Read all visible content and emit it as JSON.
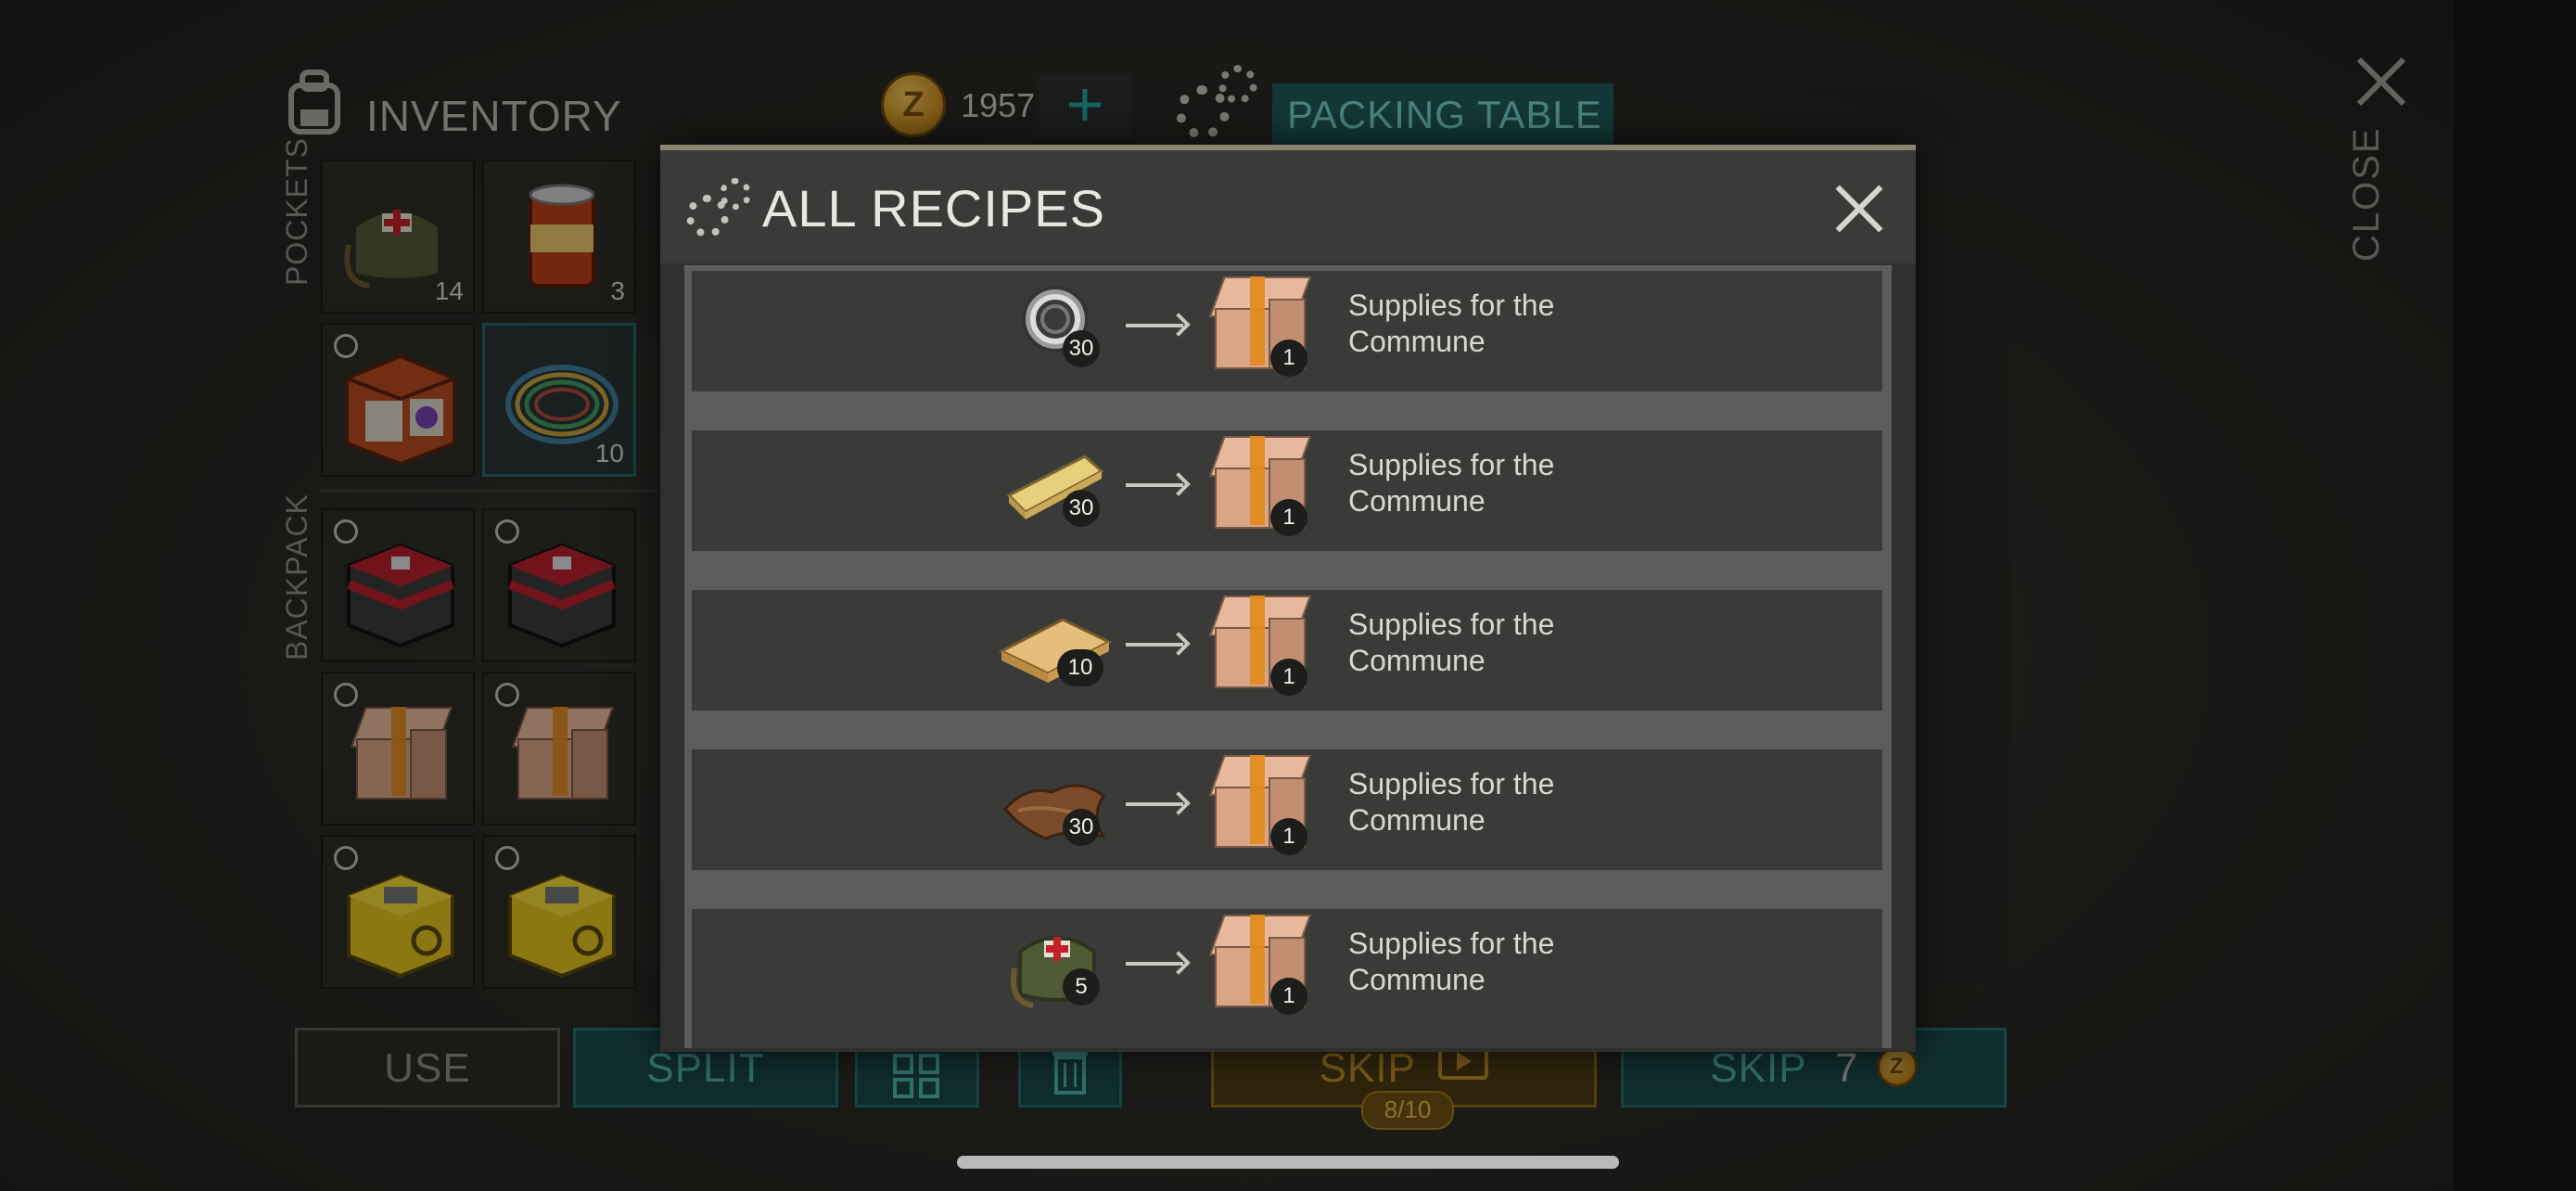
{
  "inventory": {
    "title": "INVENTORY",
    "pockets_label": "POCKETS",
    "backpack_label": "BACKPACK",
    "pocket_slots": [
      {
        "icon": "medical-bag-icon",
        "count": "14"
      },
      {
        "icon": "food-can-icon",
        "count": "3"
      },
      {
        "icon": "supply-crate-icon",
        "count": ""
      },
      {
        "icon": "rope-icon",
        "count": "10"
      }
    ],
    "backpack_slots": [
      {
        "icon": "toolbox-icon"
      },
      {
        "icon": "toolbox-icon"
      },
      {
        "icon": "cardboard-box-icon"
      },
      {
        "icon": "cardboard-box-icon"
      },
      {
        "icon": "hazard-case-icon"
      },
      {
        "icon": "hazard-case-icon"
      }
    ]
  },
  "currency": {
    "icon": "coin-icon",
    "coin_symbol": "Z",
    "amount": "1957",
    "add_label": "+"
  },
  "workbench": {
    "title": "PACKING TABLE"
  },
  "close": {
    "label": "CLOSE"
  },
  "actions": {
    "use": "USE",
    "split": "SPLIT",
    "skip_ad": "SKIP",
    "skip_ad_counter": "8/10",
    "skip_coins": "SKIP",
    "skip_coins_cost": "7"
  },
  "modal": {
    "title": "ALL RECIPES",
    "recipes": [
      {
        "input_icon": "bearing-icon",
        "input_qty": "30",
        "output_icon": "cardboard-box-icon",
        "output_qty": "1",
        "output_name": "Supplies for the Commune"
      },
      {
        "input_icon": "wood-plank-icon",
        "input_qty": "30",
        "output_icon": "cardboard-box-icon",
        "output_qty": "1",
        "output_name": "Supplies for the Commune"
      },
      {
        "input_icon": "board-icon",
        "input_qty": "10",
        "output_icon": "cardboard-box-icon",
        "output_qty": "1",
        "output_name": "Supplies for the Commune"
      },
      {
        "input_icon": "leather-icon",
        "input_qty": "30",
        "output_icon": "cardboard-box-icon",
        "output_qty": "1",
        "output_name": "Supplies for the Commune"
      },
      {
        "input_icon": "medical-bag-icon",
        "input_qty": "5",
        "output_icon": "cardboard-box-icon",
        "output_qty": "1",
        "output_name": "Supplies for the Commune"
      }
    ]
  },
  "colors": {
    "accent_teal": "#22716f",
    "gold": "#c79327",
    "panel": "#3a3b39"
  }
}
